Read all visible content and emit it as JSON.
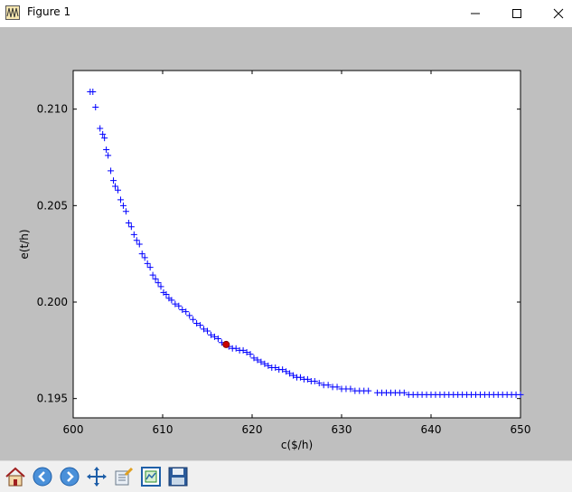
{
  "window": {
    "title": "Figure 1",
    "icons": [
      "app-figure-icon",
      "minimize-icon",
      "maximize-icon",
      "close-icon"
    ]
  },
  "toolbar": {
    "buttons": [
      "home-icon",
      "back-icon",
      "forward-icon",
      "pan-icon",
      "configure-subplots-icon",
      "zoom-rect-icon",
      "save-icon"
    ]
  },
  "colors": {
    "marker": "#0000ff",
    "highlight": "#cc0000",
    "figure_bg": "#bfbfbf",
    "axes_bg": "#ffffff"
  },
  "chart_data": {
    "type": "scatter",
    "title": "",
    "xlabel": "c($/h)",
    "ylabel": "e(t/h)",
    "xlim": [
      600,
      650
    ],
    "ylim": [
      0.194,
      0.212
    ],
    "xticks": [
      600,
      610,
      620,
      630,
      640,
      650
    ],
    "yticks": [
      0.195,
      0.2,
      0.205,
      0.21
    ],
    "xtick_labels": [
      "600",
      "610",
      "620",
      "630",
      "640",
      "650"
    ],
    "ytick_labels": [
      "0.195",
      "0.200",
      "0.205",
      "0.210"
    ],
    "grid": false,
    "marker": "+",
    "series": [
      {
        "x": [
          601.9,
          602.2,
          602.5,
          603.0,
          603.3,
          603.5,
          603.7,
          603.9,
          604.2,
          604.5,
          604.7,
          605.0,
          605.3,
          605.6,
          605.9,
          606.2,
          606.5,
          606.8,
          607.1,
          607.4,
          607.7,
          608.0,
          608.3,
          608.6,
          608.9,
          609.2,
          609.5,
          609.8,
          610.1,
          610.4,
          610.7,
          611.0,
          611.4,
          611.8,
          612.2,
          612.6,
          613.0,
          613.4,
          613.8,
          614.2,
          614.6,
          615.0,
          615.4,
          615.8,
          616.2,
          616.6,
          617.0,
          617.4,
          617.8,
          618.2,
          618.6,
          619.0,
          619.4,
          619.8,
          620.2,
          620.6,
          621.0,
          621.4,
          621.8,
          622.2,
          622.6,
          623.0,
          623.4,
          623.8,
          624.2,
          624.6,
          625.0,
          625.4,
          625.8,
          626.2,
          626.6,
          627.0,
          627.5,
          628.0,
          628.5,
          629.0,
          629.5,
          630.0,
          630.5,
          631.0,
          631.5,
          632.0,
          632.5,
          633.0,
          634.0,
          634.5,
          635.0,
          635.5,
          636.0,
          636.5,
          637.0,
          637.5,
          638.0,
          638.5,
          639.0,
          639.5,
          640.0,
          640.5,
          641.0,
          641.5,
          642.0,
          642.5,
          643.0,
          643.5,
          644.0,
          644.5,
          645.0,
          645.5,
          646.0,
          646.5,
          647.0,
          647.5,
          648.0,
          648.5,
          649.0,
          649.5,
          650.0
        ],
        "y": [
          0.2109,
          0.2109,
          0.2101,
          0.209,
          0.2087,
          0.2085,
          0.2079,
          0.2076,
          0.2068,
          0.2063,
          0.206,
          0.2058,
          0.2053,
          0.205,
          0.2047,
          0.2041,
          0.2039,
          0.2035,
          0.2032,
          0.203,
          0.2025,
          0.2023,
          0.202,
          0.2018,
          0.2014,
          0.2012,
          0.201,
          0.2008,
          0.2005,
          0.2004,
          0.2002,
          0.2001,
          0.1999,
          0.1998,
          0.1996,
          0.1995,
          0.1993,
          0.1991,
          0.1989,
          0.1988,
          0.1986,
          0.1985,
          0.1983,
          0.1982,
          0.1981,
          0.1979,
          0.1978,
          0.1977,
          0.1976,
          0.1976,
          0.1975,
          0.1975,
          0.1974,
          0.1973,
          0.1971,
          0.197,
          0.1969,
          0.1968,
          0.1967,
          0.1966,
          0.1966,
          0.1965,
          0.1965,
          0.1964,
          0.1963,
          0.1962,
          0.1961,
          0.1961,
          0.196,
          0.196,
          0.1959,
          0.1959,
          0.1958,
          0.1957,
          0.1957,
          0.1956,
          0.1956,
          0.1955,
          0.1955,
          0.1955,
          0.1954,
          0.1954,
          0.1954,
          0.1954,
          0.1953,
          0.1953,
          0.1953,
          0.1953,
          0.1953,
          0.1953,
          0.1953,
          0.1952,
          0.1952,
          0.1952,
          0.1952,
          0.1952,
          0.1952,
          0.1952,
          0.1952,
          0.1952,
          0.1952,
          0.1952,
          0.1952,
          0.1952,
          0.1952,
          0.1952,
          0.1952,
          0.1952,
          0.1952,
          0.1952,
          0.1952,
          0.1952,
          0.1952,
          0.1952,
          0.1952,
          0.1952,
          0.1952
        ]
      }
    ],
    "highlight_point": {
      "x": 617.1,
      "y": 0.1978
    }
  }
}
